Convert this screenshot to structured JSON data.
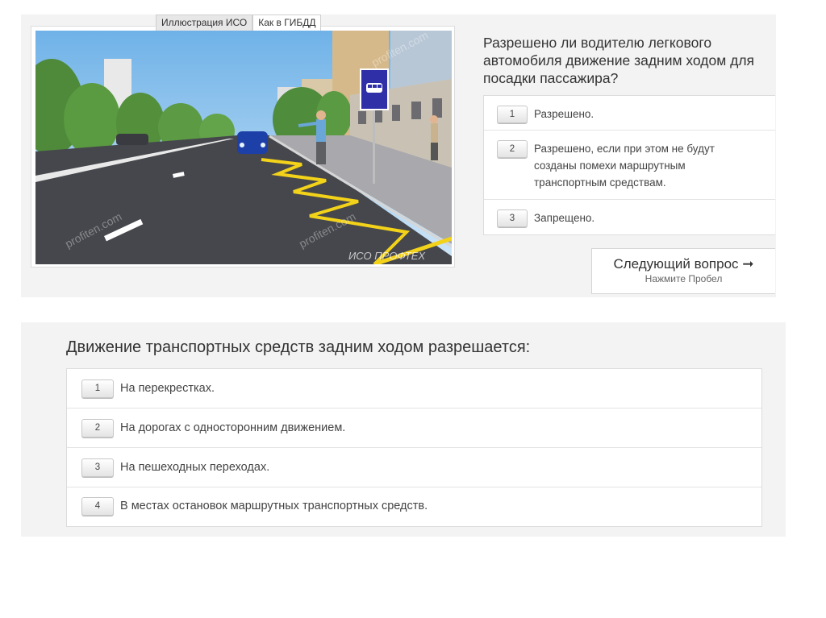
{
  "tabs": [
    {
      "label": "Иллюстрация ИСО",
      "active": false
    },
    {
      "label": "Как в ГИБДД",
      "active": true
    }
  ],
  "illustration": {
    "watermarks": [
      "profiten.com",
      "profiten.com",
      "profiten.com"
    ],
    "brand": "ИСО ПРОФТЕХ",
    "colors": {
      "sky": "#8fc6ef",
      "road": "#45474c",
      "sidewalk": "#a8a8ad",
      "marking": "#f3d21a",
      "sign": "#2f2fa8"
    }
  },
  "question1": {
    "text": "Разрешено ли водителю легкового автомобиля движение задним ходом для посадки пассажира?",
    "answers": [
      {
        "num": "1",
        "text": "Разрешено."
      },
      {
        "num": "2",
        "text": "Разрешено, если при этом не будут созданы помехи маршрутным транспортным средствам."
      },
      {
        "num": "3",
        "text": "Запрещено."
      }
    ]
  },
  "next_button": {
    "label": "Следующий вопрос ➞",
    "hint": "Нажмите Пробел"
  },
  "question2": {
    "text": "Движение транспортных средств задним ходом разрешается:",
    "answers": [
      {
        "num": "1",
        "text": "На перекрестках."
      },
      {
        "num": "2",
        "text": "На дорогах с односторонним движением."
      },
      {
        "num": "3",
        "text": "На пешеходных переходах."
      },
      {
        "num": "4",
        "text": "В местах остановок маршрутных транспортных средств."
      }
    ]
  }
}
